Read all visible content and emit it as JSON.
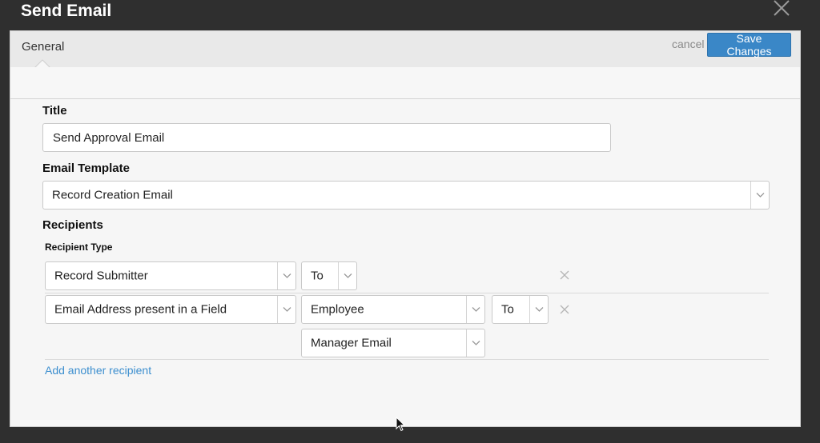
{
  "modal": {
    "title": "Send Email"
  },
  "tabs": {
    "general": "General"
  },
  "actions": {
    "cancel": "cancel",
    "save": "Save Changes"
  },
  "form": {
    "title_label": "Title",
    "title_value": "Send Approval Email",
    "template_label": "Email Template",
    "template_value": "Record Creation Email",
    "recipients_label": "Recipients",
    "recipient_type_label": "Recipient Type",
    "recipients": [
      {
        "type": "Record Submitter",
        "mode": "To"
      },
      {
        "type": "Email Address present in a Field",
        "field": "Employee",
        "mode": "To",
        "subfield": "Manager Email"
      }
    ],
    "add_recipient": "Add another recipient"
  },
  "icons": {
    "close": "close-icon",
    "dropdown": "chevron-down-icon",
    "remove": "remove-icon",
    "cursor": "mouse-pointer-icon"
  },
  "colors": {
    "accent": "#3a87c7",
    "link": "#3d8fcf",
    "backdrop": "#2f2f2f"
  }
}
